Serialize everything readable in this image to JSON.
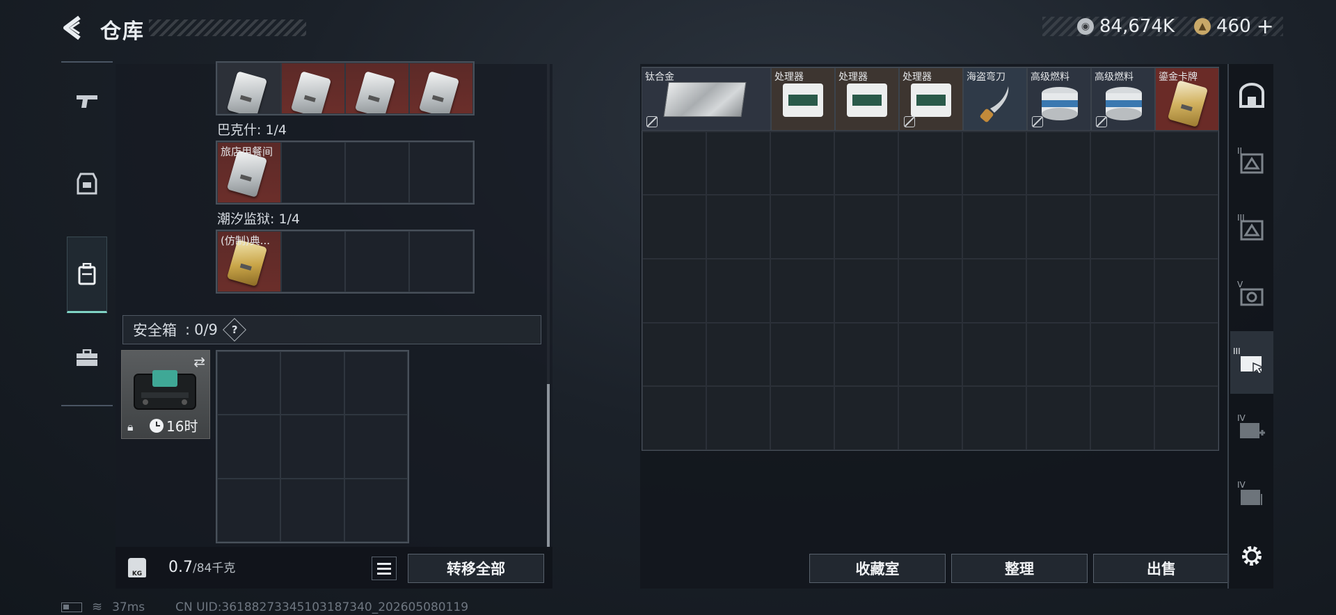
{
  "header": {
    "title": "仓库",
    "currency1": "84,674K",
    "currency2": "460",
    "currency2_plus": "+"
  },
  "left_nav": {
    "items": [
      "pistol-icon",
      "armor-icon",
      "backpack-icon",
      "briefcase-icon"
    ],
    "active_index": 2
  },
  "left_panel": {
    "top_row": [
      {
        "label": "",
        "bg": "plain"
      },
      {
        "label": "",
        "bg": "red"
      },
      {
        "label": "",
        "bg": "red"
      },
      {
        "label": "",
        "bg": "red"
      }
    ],
    "sections": [
      {
        "title": "巴克什: 1/4",
        "first_item_label": "旅店用餐间"
      },
      {
        "title": "潮汐监狱: 1/4",
        "first_item_label": "(仿制)典..."
      }
    ],
    "safe_box": {
      "label": "安全箱",
      "value": "0/9",
      "help": "?",
      "timer": "16时"
    },
    "weight": {
      "current": "0.7",
      "max": "/84千克"
    },
    "transfer_all": "转移全部"
  },
  "right_panel": {
    "items": [
      {
        "label": "钛合金",
        "type": "titanium"
      },
      {
        "label": "处理器",
        "type": "processor"
      },
      {
        "label": "处理器",
        "type": "processor"
      },
      {
        "label": "处理器",
        "type": "processor"
      },
      {
        "label": "海盗弯刀",
        "type": "knife"
      },
      {
        "label": "高级燃料",
        "type": "fuel"
      },
      {
        "label": "高级燃料",
        "type": "fuel"
      },
      {
        "label": "鎏金卡牌",
        "type": "gold-card"
      }
    ],
    "buttons": {
      "collection": "收藏室",
      "sort": "整理",
      "sell": "出售"
    }
  },
  "right_nav": {
    "items": [
      {
        "roman": "",
        "name": "vault-icon"
      },
      {
        "roman": "II",
        "name": "tier2-a-icon"
      },
      {
        "roman": "III",
        "name": "tier3-a-icon"
      },
      {
        "roman": "V",
        "name": "tier5-icon"
      },
      {
        "roman": "III",
        "name": "tier3-b-icon"
      },
      {
        "roman": "IV",
        "name": "tier4-a-icon"
      },
      {
        "roman": "IV",
        "name": "tier4-b-icon"
      }
    ],
    "active_index": 4
  },
  "status_bar": {
    "ping": "37ms",
    "uid": "CN UID:36188273345103187340_202605080119"
  },
  "colors": {
    "accent": "#7fd3c4",
    "red_slot": "#6b2e2a",
    "panel": "#1d2228"
  }
}
